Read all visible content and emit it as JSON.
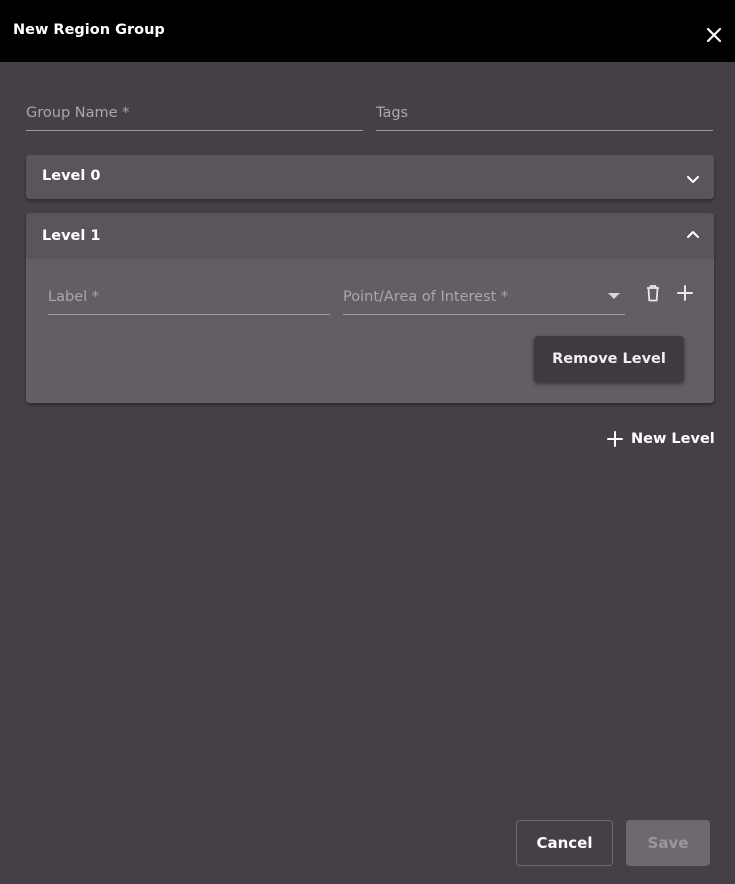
{
  "dialog": {
    "title": "New Region Group",
    "close_icon": "close-icon"
  },
  "form": {
    "group_name": {
      "value": "",
      "placeholder": "Group Name *"
    },
    "tags": {
      "value": "",
      "placeholder": "Tags"
    }
  },
  "levels": [
    {
      "title": "Level 0",
      "expanded": false,
      "chevron_icon": "chevron-down-icon"
    },
    {
      "title": "Level 1",
      "expanded": true,
      "chevron_icon": "chevron-up-icon",
      "label_field": {
        "value": "",
        "placeholder": "Label *"
      },
      "poi_field": {
        "value": "",
        "placeholder": "Point/Area of Interest *",
        "dropdown_icon": "caret-down-icon"
      },
      "delete_icon": "trash-icon",
      "add_icon": "plus-icon",
      "remove_label": "Remove Level"
    }
  ],
  "new_level": {
    "label": "New Level",
    "icon": "plus-icon"
  },
  "footer": {
    "cancel_label": "Cancel",
    "save_label": "Save",
    "save_enabled": false
  },
  "colors": {
    "background": "#444046",
    "header": "#000000",
    "panel": "#59555b",
    "panel_body": "#625e64"
  }
}
